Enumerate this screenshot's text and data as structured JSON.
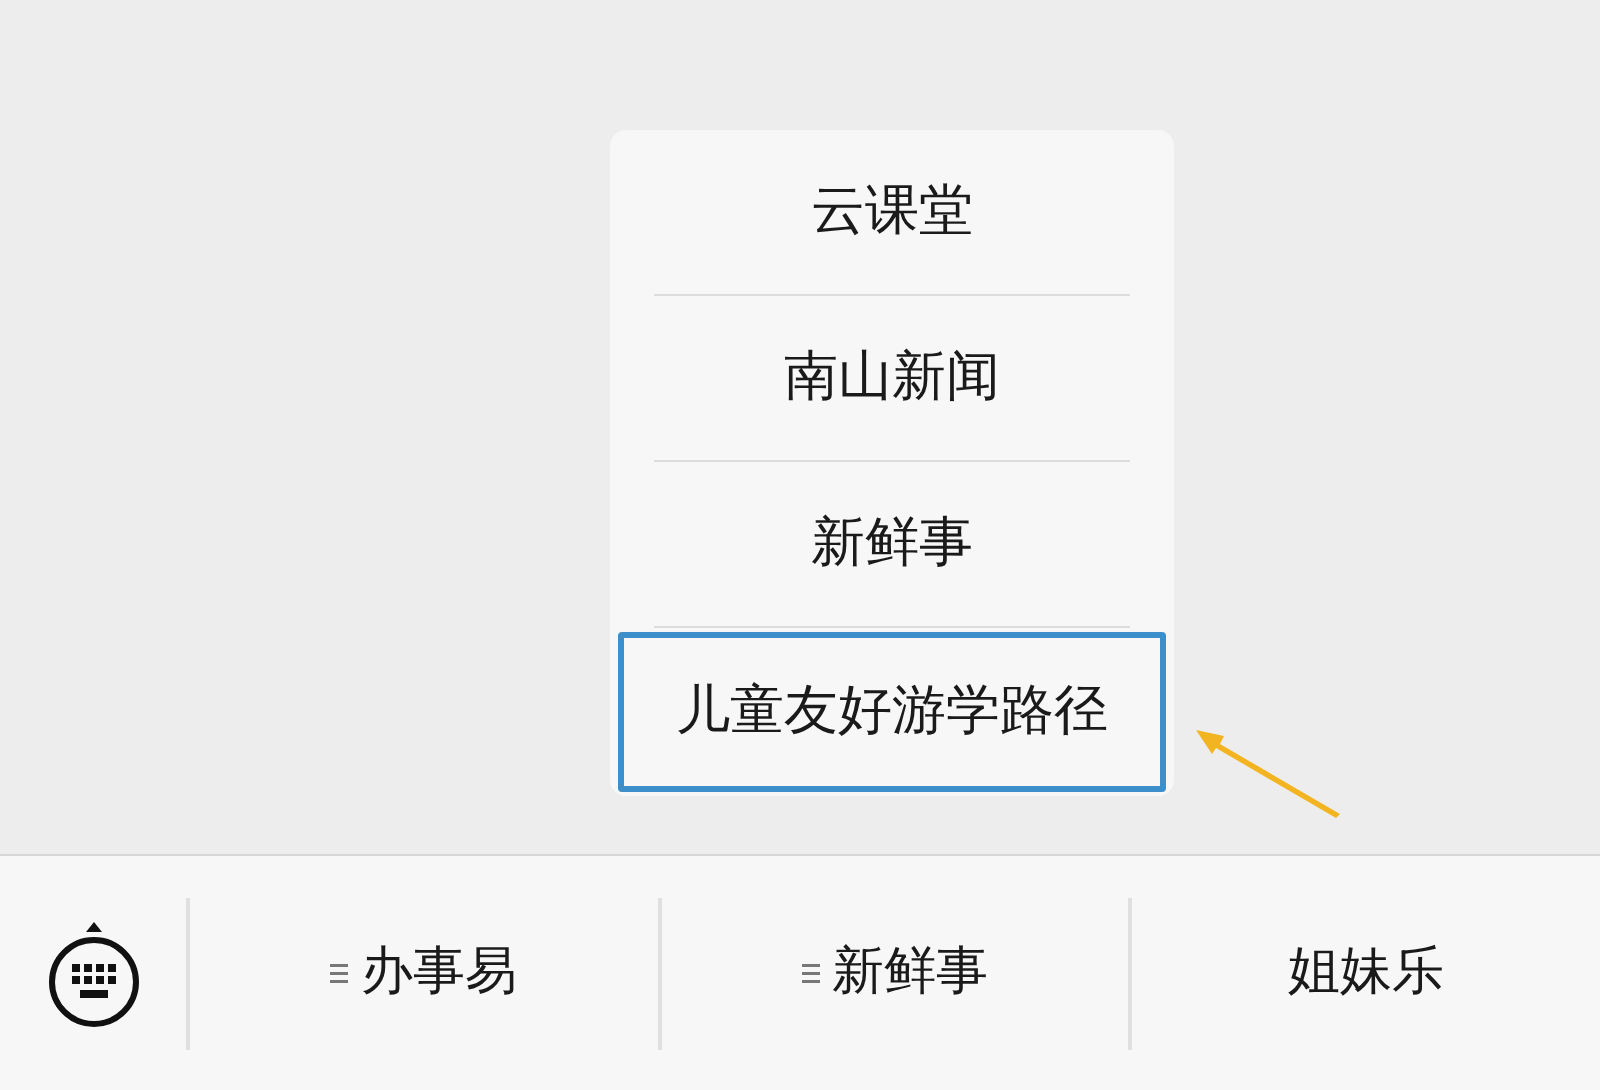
{
  "popup_menu": {
    "items": [
      {
        "label": "云课堂",
        "highlighted": false
      },
      {
        "label": "南山新闻",
        "highlighted": false
      },
      {
        "label": "新鲜事",
        "highlighted": false
      },
      {
        "label": "儿童友好游学路径",
        "highlighted": true
      }
    ]
  },
  "bottom_menu": {
    "items": [
      {
        "label": "办事易",
        "has_submenu": true
      },
      {
        "label": "新鲜事",
        "has_submenu": true
      },
      {
        "label": "姐妹乐",
        "has_submenu": false
      }
    ]
  }
}
